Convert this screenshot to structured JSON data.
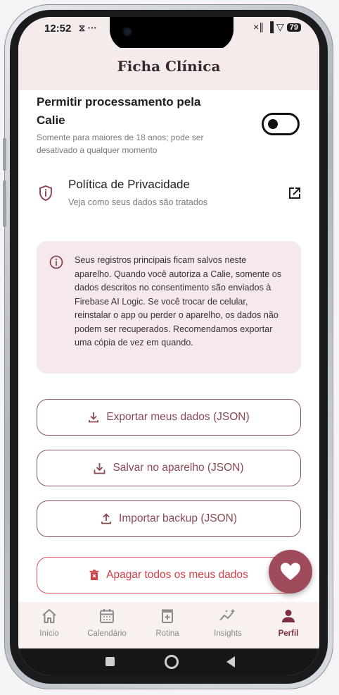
{
  "status_bar": {
    "time": "12:52",
    "left_icons": "⧖ ···",
    "signal": "×∥ ▐ ▽",
    "battery": "79"
  },
  "header": {
    "title": "Ficha Clínica"
  },
  "consent": {
    "title_line1": "Permitir processamento pela",
    "title_line2": "Calie",
    "subtitle_line1": "Somente para maiores de 18 anos; pode ser",
    "subtitle_line2": "desativado a qualquer momento",
    "toggle_on": false
  },
  "privacy": {
    "title": "Política de Privacidade",
    "subtitle": "Veja como seus dados são tratados"
  },
  "info": {
    "text": "Seus registros principais ficam salvos neste aparelho. Quando você autoriza a Calie, somente os dados descritos no consentimento são enviados à Firebase AI Logic. Se você trocar de celular, reinstalar o app ou perder o aparelho, os dados não podem ser recuperados. Recomendamos exportar uma cópia de vez em quando."
  },
  "buttons": {
    "export": "Exportar meus dados (JSON)",
    "save": "Salvar no aparelho (JSON)",
    "import": "Importar backup (JSON)",
    "delete": "Apagar todos os meus dados"
  },
  "nav": {
    "items": [
      {
        "label": "Início",
        "icon": "home-icon"
      },
      {
        "label": "Calendário",
        "icon": "calendar-icon"
      },
      {
        "label": "Rotina",
        "icon": "medkit-icon"
      },
      {
        "label": "Insights",
        "icon": "insights-icon"
      },
      {
        "label": "Perfil",
        "icon": "person-icon"
      }
    ],
    "active": "Perfil"
  },
  "colors": {
    "accent": "#a04b5b",
    "danger": "#d23f46",
    "header_bg": "#f5ebeb",
    "info_bg": "#f6e9ec"
  }
}
